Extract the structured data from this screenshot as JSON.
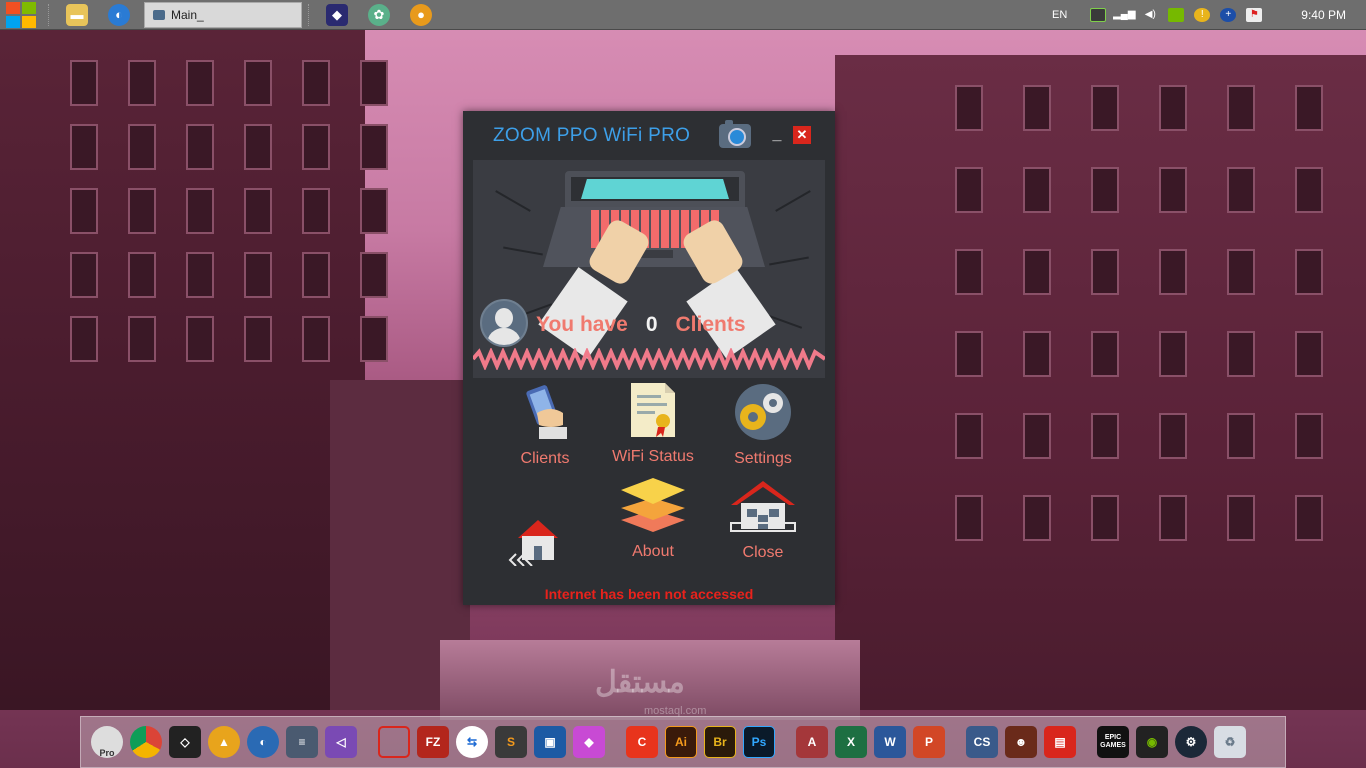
{
  "taskbar": {
    "active_task_label": "Main_",
    "language": "EN",
    "clock": "9:40 PM"
  },
  "app": {
    "title": "ZOOM PPO WiFi PRO",
    "minimize_label": "_",
    "close_label": "✕",
    "clients": {
      "prefix": "You have",
      "count": "0",
      "suffix": "Clients"
    },
    "menu": {
      "clients": "Clients",
      "wifi_status": "WiFi Status",
      "settings": "Settings",
      "home": "",
      "about": "About",
      "close": "Close"
    },
    "status_message": "Internet has been not accessed"
  },
  "dock": {
    "pro_badge": "Pro",
    "apps": [
      "FZ",
      "Ai",
      "Br",
      "Ps",
      "CS",
      "EPIC GAMES"
    ]
  },
  "watermark": {
    "arabic": "مستقل",
    "latin": "mostaql.com"
  },
  "colors": {
    "title_blue": "#3d9fe8",
    "accent_coral": "#f07a6f",
    "status_red": "#e8221c",
    "window_bg": "#2d2f33"
  }
}
